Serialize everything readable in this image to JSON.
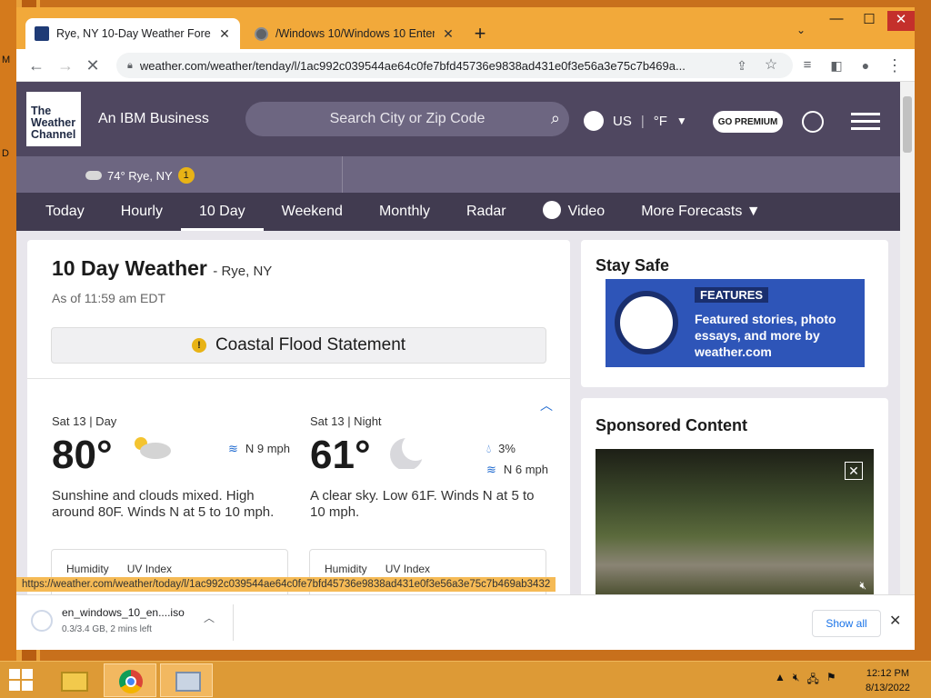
{
  "browser": {
    "tabs": [
      {
        "title": "Rye, NY 10-Day Weather Forecas",
        "favicon": "twc-logo-icon"
      },
      {
        "title": "/Windows 10/Windows 10 Enterp",
        "favicon": "globe-icon"
      }
    ],
    "new_tab": "+",
    "window_controls": {
      "minimize": "—",
      "maximize": "☐",
      "close": "✕"
    },
    "url": "weather.com/weather/tenday/l/1ac992c039544ae64c0fe7bfd45736e9838ad431e0f3e56a3e75c7b469a..."
  },
  "header": {
    "logo_lines": [
      "The",
      "Weather",
      "Channel"
    ],
    "tagline": "An IBM Business",
    "search_placeholder": "Search City or Zip Code",
    "locale": "US",
    "unit": "°F",
    "premium": "GO PREMIUM"
  },
  "location_bar": {
    "temp_location": "74° Rye, NY",
    "alert_count": "1"
  },
  "nav": {
    "items": [
      "Today",
      "Hourly",
      "10 Day",
      "Weekend",
      "Monthly",
      "Radar",
      "Video",
      "More Forecasts"
    ],
    "active": "10 Day"
  },
  "main": {
    "title": "10 Day Weather",
    "location": "- Rye, NY",
    "as_of": "As of 11:59 am EDT",
    "alert": "Coastal Flood Statement",
    "day": {
      "label": "Sat 13 | Day",
      "temp": "80°",
      "wind": "N 9 mph",
      "description": "Sunshine and clouds mixed. High around 80F. Winds N at 5 to 10 mph.",
      "humidity_label": "Humidity",
      "uv_label": "UV Index"
    },
    "night": {
      "label": "Sat 13 | Night",
      "temp": "61°",
      "precip": "3%",
      "wind": "N 6 mph",
      "description": "A clear sky. Low 61F. Winds N at 5 to 10 mph.",
      "humidity_label": "Humidity",
      "uv_label": "UV Index"
    }
  },
  "sidebar": {
    "stay_safe_title": "Stay Safe",
    "feature_label": "FEATURES",
    "feature_text": "Featured stories, photo essays, and more by weather.com",
    "sponsored_title": "Sponsored Content"
  },
  "status_url": "https://weather.com/weather/today/l/1ac992c039544ae64c0fe7bfd45736e9838ad431e0f3e56a3e75c7b469ab3432",
  "download": {
    "filename": "en_windows_10_en....iso",
    "progress": "0.3/3.4 GB, 2 mins left",
    "show_all": "Show all"
  },
  "taskbar": {
    "time": "12:12 PM",
    "date": "8/13/2022"
  },
  "desktop_labels": [
    "M",
    "D"
  ],
  "colors": {
    "twc_header": "#4f4760",
    "nav_bar": "#413b50",
    "alert_yellow": "#e8b316",
    "link_blue": "#1f6ad0"
  }
}
